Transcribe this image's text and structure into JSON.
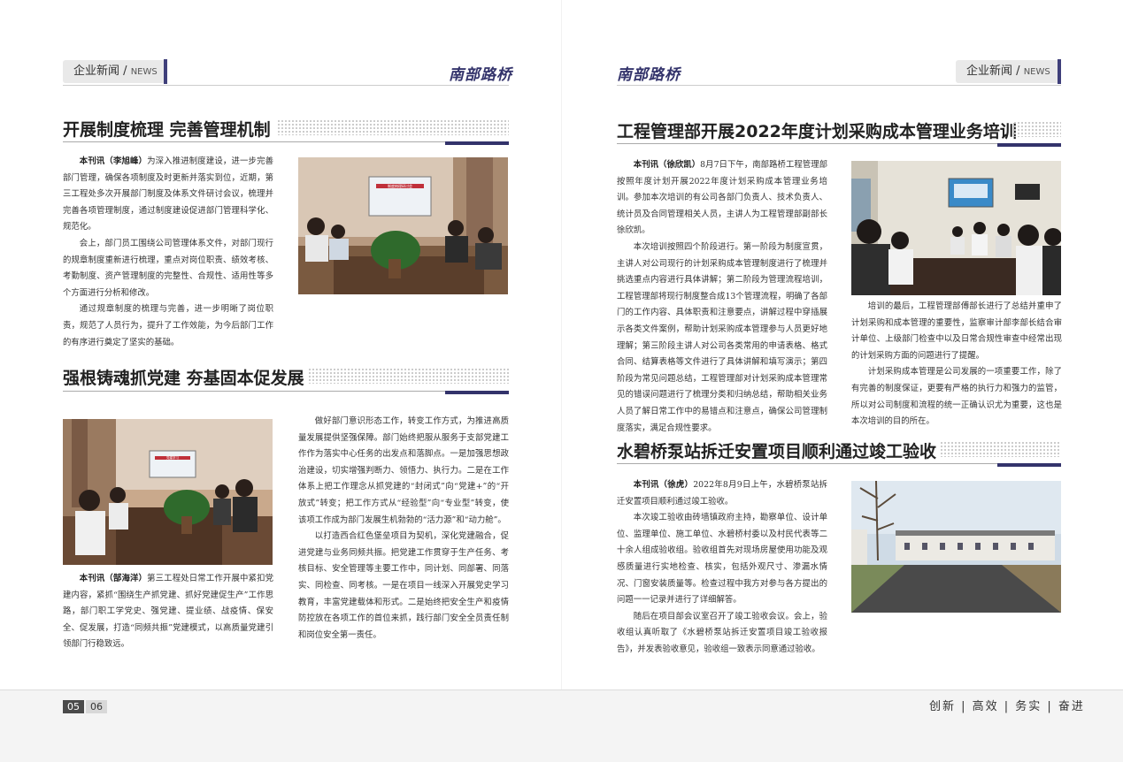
{
  "brand": "南部路桥",
  "section": {
    "zh": "企业新闻",
    "sep": "/",
    "en": "NEWS"
  },
  "left": {
    "article1": {
      "title": "开展制度梳理 完善管理机制",
      "byline": "本刊讯（李旭峰）",
      "paragraphs": [
        "为深入推进制度建设，进一步完善部门管理，确保各项制度及时更新并落实到位，近期，第三工程处多次开展部门制度及体系文件研讨会议，梳理并完善各项管理制度，通过制度建设促进部门管理科学化、规范化。",
        "会上，部门员工围绕公司管理体系文件，对部门现行的规章制度重新进行梳理，重点对岗位职责、绩效考核、考勤制度、资产管理制度的完整性、合规性、适用性等多个方面进行分析和修改。",
        "通过规章制度的梳理与完善，进一步明晰了岗位职责，规范了人员行为，提升了工作效能，为今后部门工作的有序进行奠定了坚实的基础。"
      ]
    },
    "article2": {
      "title": "强根铸魂抓党建 夯基固本促发展",
      "byline": "本刊讯（郜海洋）",
      "lead": "第三工程处日常工作开展中紧扣党建内容，紧抓“围绕生产抓党建、抓好党建促生产”工作思路，部门职工学党史、强党建、提业绩、战疫情、保安全、促发展，打造“同频共振”党建模式，以高质量党建引领部门行稳致远。",
      "paragraphs": [
        "做好部门意识形态工作，转变工作方式，为推进高质量发展提供坚强保障。部门始终把服从服务于支部党建工作作为落实中心任务的出发点和落脚点。一是加强思想政治建设，切实增强判断力、领悟力、执行力。二是在工作体系上把工作理念从抓党建的“封闭式”向“党建+”的“开放式”转变；把工作方式从“经验型”向“专业型”转变，使该项工作成为部门发展生机勃勃的“活力源”和“动力舱”。",
        "以打造西合红色堡垒项目为契机，深化党建融合，促进党建与业务同频共振。把党建工作贯穿于生产任务、考核目标、安全管理等主要工作中，同计划、同部署、同落实、同检查、同考核。一是在项目一线深入开展党史学习教育，丰富党建载体和形式。二是始终把安全生产和疫情防控放在各项工作的首位来抓，践行部门安全全员责任制和岗位安全第一责任。"
      ]
    },
    "meeting_screen_text": "制度梳理研讨会",
    "party_screen_text": "党建学习"
  },
  "right": {
    "article1": {
      "title": "工程管理部开展2022年度计划采购成本管理业务培训",
      "byline": "本刊讯（徐欣凯）",
      "paragraphs": [
        "8月7日下午，南部路桥工程管理部按照年度计划开展2022年度计划采购成本管理业务培训。参加本次培训的有公司各部门负责人、技术负责人、统计员及合同管理相关人员，主讲人为工程管理部副部长徐欣凯。",
        "本次培训按照四个阶段进行。第一阶段为制度宣贯，主讲人对公司现行的计划采购成本管理制度进行了梳理并挑选重点内容进行具体讲解；第二阶段为管理流程培训，工程管理部将现行制度整合成13个管理流程，明确了各部门的工作内容、具体职责和注意要点，讲解过程中穿插展示各类文件案例，帮助计划采购成本管理参与人员更好地理解；第三阶段主讲人对公司各类常用的申请表格、格式合同、结算表格等文件进行了具体讲解和填写演示；第四阶段为常见问题总结，工程管理部对计划采购成本管理常见的错误问题进行了梳理分类和归纳总结，帮助相关业务人员了解日常工作中的易错点和注意点，确保公司管理制度落实，满足合规性要求。"
      ],
      "side_paragraphs": [
        "培训的最后，工程管理部傅部长进行了总结并重申了计划采购和成本管理的重要性，监察审计部李部长结合审计单位、上级部门检查中以及日常合规性审查中经常出现的计划采购方面的问题进行了提醒。",
        "计划采购成本管理是公司发展的一项重要工作，除了有完善的制度保证，更要有严格的执行力和强力的监管，所以对公司制度和流程的统一正确认识尤为重要，这也是本次培训的目的所在。"
      ]
    },
    "article2": {
      "title": "水碧桥泵站拆迁安置项目顺利通过竣工验收",
      "byline": "本刊讯（徐虎）",
      "paragraphs": [
        "2022年8月9日上午，水碧桥泵站拆迁安置项目顺利通过竣工验收。",
        "本次竣工验收由砖墙镇政府主持，勘察单位、设计单位、监理单位、施工单位、水碧桥村委以及村民代表等二十余人组成验收组。验收组首先对现场房屋使用功能及观感质量进行实地检查、核实，包括外观尺寸、渗漏水情况、门窗安装质量等。检查过程中我方对参与各方提出的问题一一记录并进行了详细解答。",
        "随后在项目部会议室召开了竣工验收会议。会上，验收组认真听取了《水碧桥泵站拆迁安置项目竣工验收报告》，并发表验收意见，验收组一致表示同意通过验收。"
      ]
    }
  },
  "footer": {
    "page_left": "05",
    "page_right": "06",
    "slogan": "创新 | 高效 | 务实 | 奋进"
  },
  "colors": {
    "accent": "#33336b",
    "tag_bg": "#e9e9e9",
    "footer_bg": "#f4f4f4"
  }
}
